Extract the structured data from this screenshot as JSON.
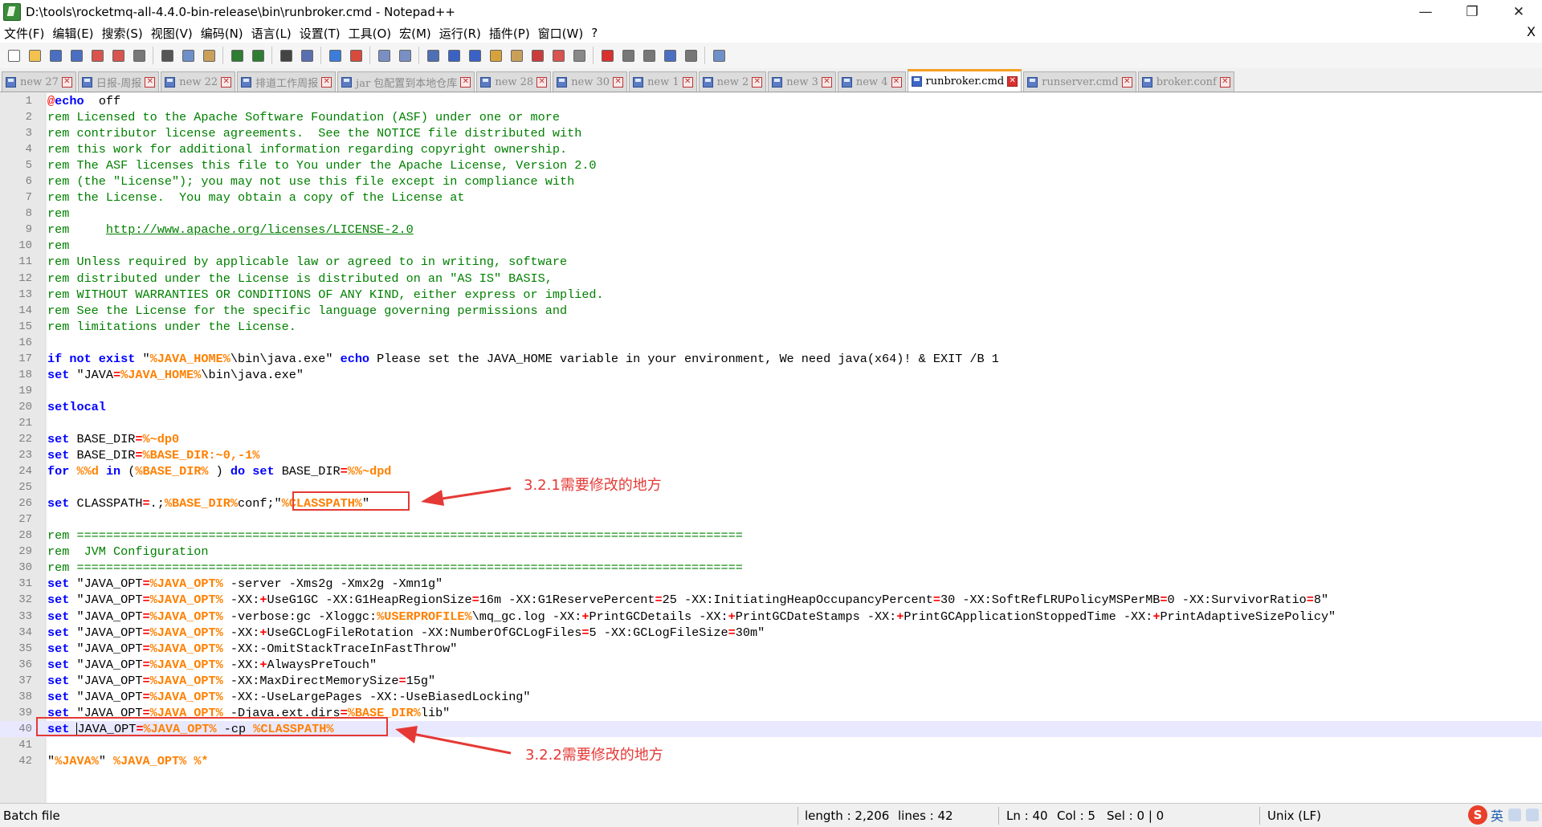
{
  "window": {
    "title": "D:\\tools\\rocketmq-all-4.4.0-bin-release\\bin\\runbroker.cmd - Notepad++",
    "minimize_glyph": "—",
    "restore_glyph": "❐",
    "close_glyph": "✕"
  },
  "menu": {
    "items": [
      "文件(F)",
      "编辑(E)",
      "搜索(S)",
      "视图(V)",
      "编码(N)",
      "语言(L)",
      "设置(T)",
      "工具(O)",
      "宏(M)",
      "运行(R)",
      "插件(P)",
      "窗口(W)",
      "?"
    ],
    "close_glyph": "X"
  },
  "toolbar": {
    "icons": [
      {
        "name": "new-file-icon",
        "color": "#ffffff"
      },
      {
        "name": "open-file-icon",
        "color": "#f2c14e"
      },
      {
        "name": "save-icon",
        "color": "#4a6fc2"
      },
      {
        "name": "save-all-icon",
        "color": "#4a6fc2"
      },
      {
        "name": "close-icon",
        "color": "#d9534f"
      },
      {
        "name": "close-all-icon",
        "color": "#d9534f"
      },
      {
        "name": "print-icon",
        "color": "#777777"
      },
      {
        "name": "sep"
      },
      {
        "name": "cut-icon",
        "color": "#555555"
      },
      {
        "name": "copy-icon",
        "color": "#6f8fc9"
      },
      {
        "name": "paste-icon",
        "color": "#c9a05a"
      },
      {
        "name": "sep"
      },
      {
        "name": "undo-icon",
        "color": "#2e7d32"
      },
      {
        "name": "redo-icon",
        "color": "#2e7d32"
      },
      {
        "name": "sep"
      },
      {
        "name": "find-icon",
        "color": "#444444"
      },
      {
        "name": "replace-icon",
        "color": "#5a6fb0"
      },
      {
        "name": "sep"
      },
      {
        "name": "zoom-in-icon",
        "color": "#3b7dd8"
      },
      {
        "name": "zoom-out-icon",
        "color": "#d84a3b"
      },
      {
        "name": "sep"
      },
      {
        "name": "sync-vertical-icon",
        "color": "#7a8fc4"
      },
      {
        "name": "sync-horizontal-icon",
        "color": "#7a8fc4"
      },
      {
        "name": "sep"
      },
      {
        "name": "word-wrap-icon",
        "color": "#4f6fb5"
      },
      {
        "name": "show-all-chars-icon",
        "color": "#3a62c5"
      },
      {
        "name": "indent-guide-icon",
        "color": "#3a62c5"
      },
      {
        "name": "user-language-icon",
        "color": "#d8a23b"
      },
      {
        "name": "doc-map-icon",
        "color": "#c9a05a"
      },
      {
        "name": "function-list-icon",
        "color": "#cc3b3b"
      },
      {
        "name": "folder-workspace-icon",
        "color": "#d9534f"
      },
      {
        "name": "monitoring-icon",
        "color": "#888888"
      },
      {
        "name": "sep"
      },
      {
        "name": "record-macro-icon",
        "color": "#d9312f"
      },
      {
        "name": "stop-macro-icon",
        "color": "#777777"
      },
      {
        "name": "play-macro-icon",
        "color": "#777777"
      },
      {
        "name": "run-macro-multiple-icon",
        "color": "#4a6fc2"
      },
      {
        "name": "save-macro-icon",
        "color": "#777777"
      },
      {
        "name": "sep"
      },
      {
        "name": "spell-check-icon",
        "color": "#6f8fc9"
      }
    ]
  },
  "tabs": [
    {
      "label": "new 27",
      "active": false
    },
    {
      "label": "日报-周报",
      "active": false
    },
    {
      "label": "new 22",
      "active": false
    },
    {
      "label": "排道工作周报",
      "active": false
    },
    {
      "label": "jar 包配置到本地仓库",
      "active": false
    },
    {
      "label": "new 28",
      "active": false
    },
    {
      "label": "new 30",
      "active": false
    },
    {
      "label": "new 1",
      "active": false
    },
    {
      "label": "new 2",
      "active": false
    },
    {
      "label": "new 3",
      "active": false
    },
    {
      "label": "new 4",
      "active": false
    },
    {
      "label": "runbroker.cmd",
      "active": true
    },
    {
      "label": "runserver.cmd",
      "active": false
    },
    {
      "label": "broker.conf",
      "active": false
    }
  ],
  "tab_close_glyph": "✕",
  "editor": {
    "current_line": 40,
    "lines": [
      [
        [
          "at",
          "@"
        ],
        [
          "kw",
          "echo"
        ],
        [
          "",
          "  off"
        ]
      ],
      [
        [
          "rem",
          "rem Licensed to the Apache Software Foundation (ASF) under one or more"
        ]
      ],
      [
        [
          "rem",
          "rem contributor license agreements.  See the NOTICE file distributed with"
        ]
      ],
      [
        [
          "rem",
          "rem this work for additional information regarding copyright ownership."
        ]
      ],
      [
        [
          "rem",
          "rem The ASF licenses this file to You under the Apache License, Version 2.0"
        ]
      ],
      [
        [
          "rem",
          "rem (the \"License\"); you may not use this file except in compliance with"
        ]
      ],
      [
        [
          "rem",
          "rem the License.  You may obtain a copy of the License at"
        ]
      ],
      [
        [
          "rem",
          "rem"
        ]
      ],
      [
        [
          "rem",
          "rem     "
        ],
        [
          "url",
          "http://www.apache.org/licenses/LICENSE-2.0"
        ]
      ],
      [
        [
          "rem",
          "rem"
        ]
      ],
      [
        [
          "rem",
          "rem Unless required by applicable law or agreed to in writing, software"
        ]
      ],
      [
        [
          "rem",
          "rem distributed under the License is distributed on an \"AS IS\" BASIS,"
        ]
      ],
      [
        [
          "rem",
          "rem WITHOUT WARRANTIES OR CONDITIONS OF ANY KIND, either express or implied."
        ]
      ],
      [
        [
          "rem",
          "rem See the License for the specific language governing permissions and"
        ]
      ],
      [
        [
          "rem",
          "rem limitations under the License."
        ]
      ],
      [],
      [
        [
          "kw",
          "if not exist"
        ],
        [
          "",
          " \""
        ],
        [
          "var",
          "%JAVA_HOME%"
        ],
        [
          "",
          "\\bin\\java.exe\" "
        ],
        [
          "kw",
          "echo"
        ],
        [
          "",
          " Please set the JAVA_HOME variable in your environment, We need java(x64)! & EXIT /B 1"
        ]
      ],
      [
        [
          "kw",
          "set"
        ],
        [
          "",
          " \"JAVA"
        ],
        [
          "op",
          "="
        ],
        [
          "var",
          "%JAVA_HOME%"
        ],
        [
          "",
          "\\bin\\java.exe\""
        ]
      ],
      [],
      [
        [
          "kw",
          "setlocal"
        ]
      ],
      [],
      [
        [
          "kw",
          "set"
        ],
        [
          "",
          " BASE_DIR"
        ],
        [
          "op",
          "="
        ],
        [
          "var",
          "%~dp0"
        ]
      ],
      [
        [
          "kw",
          "set"
        ],
        [
          "",
          " BASE_DIR"
        ],
        [
          "op",
          "="
        ],
        [
          "var",
          "%BASE_DIR:~0,-1%"
        ]
      ],
      [
        [
          "kw",
          "for"
        ],
        [
          "",
          " "
        ],
        [
          "var",
          "%%d"
        ],
        [
          "",
          " "
        ],
        [
          "kw",
          "in"
        ],
        [
          "",
          " ("
        ],
        [
          "var",
          "%BASE_DIR%"
        ],
        [
          "",
          " ) "
        ],
        [
          "kw",
          "do set"
        ],
        [
          "",
          " BASE_DIR"
        ],
        [
          "op",
          "="
        ],
        [
          "var",
          "%%~dpd"
        ]
      ],
      [],
      [
        [
          "kw",
          "set"
        ],
        [
          "",
          " CLASSPATH"
        ],
        [
          "op",
          "="
        ],
        [
          "",
          ".;"
        ],
        [
          "var",
          "%BASE_DIR%"
        ],
        [
          "",
          "conf;\""
        ],
        [
          "var",
          "%CLASSPATH%"
        ],
        [
          "",
          "\""
        ]
      ],
      [],
      [
        [
          "rem",
          "rem ==========================================================================================="
        ]
      ],
      [
        [
          "rem",
          "rem  JVM Configuration"
        ]
      ],
      [
        [
          "rem",
          "rem ==========================================================================================="
        ]
      ],
      [
        [
          "kw",
          "set"
        ],
        [
          "",
          " \"JAVA_OPT"
        ],
        [
          "op",
          "="
        ],
        [
          "var",
          "%JAVA_OPT%"
        ],
        [
          "",
          " -server -Xms2g -Xmx2g -Xmn1g\""
        ]
      ],
      [
        [
          "kw",
          "set"
        ],
        [
          "",
          " \"JAVA_OPT"
        ],
        [
          "op",
          "="
        ],
        [
          "var",
          "%JAVA_OPT%"
        ],
        [
          "",
          " -XX:"
        ],
        [
          "op",
          "+"
        ],
        [
          "",
          "UseG1GC -XX:G1HeapRegionSize"
        ],
        [
          "op",
          "="
        ],
        [
          "",
          "16m -XX:G1ReservePercent"
        ],
        [
          "op",
          "="
        ],
        [
          "",
          "25 -XX:InitiatingHeapOccupancyPercent"
        ],
        [
          "op",
          "="
        ],
        [
          "",
          "30 -XX:SoftRefLRUPolicyMSPerMB"
        ],
        [
          "op",
          "="
        ],
        [
          "",
          "0 -XX:SurvivorRatio"
        ],
        [
          "op",
          "="
        ],
        [
          "",
          "8\""
        ]
      ],
      [
        [
          "kw",
          "set"
        ],
        [
          "",
          " \"JAVA_OPT"
        ],
        [
          "op",
          "="
        ],
        [
          "var",
          "%JAVA_OPT%"
        ],
        [
          "",
          " -verbose:gc -Xloggc:"
        ],
        [
          "var",
          "%USERPROFILE%"
        ],
        [
          "",
          "\\mq_gc.log -XX:"
        ],
        [
          "op",
          "+"
        ],
        [
          "",
          "PrintGCDetails -XX:"
        ],
        [
          "op",
          "+"
        ],
        [
          "",
          "PrintGCDateStamps -XX:"
        ],
        [
          "op",
          "+"
        ],
        [
          "",
          "PrintGCApplicationStoppedTime -XX:"
        ],
        [
          "op",
          "+"
        ],
        [
          "",
          "PrintAdaptiveSizePolicy\""
        ]
      ],
      [
        [
          "kw",
          "set"
        ],
        [
          "",
          " \"JAVA_OPT"
        ],
        [
          "op",
          "="
        ],
        [
          "var",
          "%JAVA_OPT%"
        ],
        [
          "",
          " -XX:"
        ],
        [
          "op",
          "+"
        ],
        [
          "",
          "UseGCLogFileRotation -XX:NumberOfGCLogFiles"
        ],
        [
          "op",
          "="
        ],
        [
          "",
          "5 -XX:GCLogFileSize"
        ],
        [
          "op",
          "="
        ],
        [
          "",
          "30m\""
        ]
      ],
      [
        [
          "kw",
          "set"
        ],
        [
          "",
          " \"JAVA_OPT"
        ],
        [
          "op",
          "="
        ],
        [
          "var",
          "%JAVA_OPT%"
        ],
        [
          "",
          " -XX:-OmitStackTraceInFastThrow\""
        ]
      ],
      [
        [
          "kw",
          "set"
        ],
        [
          "",
          " \"JAVA_OPT"
        ],
        [
          "op",
          "="
        ],
        [
          "var",
          "%JAVA_OPT%"
        ],
        [
          "",
          " -XX:"
        ],
        [
          "op",
          "+"
        ],
        [
          "",
          "AlwaysPreTouch\""
        ]
      ],
      [
        [
          "kw",
          "set"
        ],
        [
          "",
          " \"JAVA_OPT"
        ],
        [
          "op",
          "="
        ],
        [
          "var",
          "%JAVA_OPT%"
        ],
        [
          "",
          " -XX:MaxDirectMemorySize"
        ],
        [
          "op",
          "="
        ],
        [
          "",
          "15g\""
        ]
      ],
      [
        [
          "kw",
          "set"
        ],
        [
          "",
          " \"JAVA_OPT"
        ],
        [
          "op",
          "="
        ],
        [
          "var",
          "%JAVA_OPT%"
        ],
        [
          "",
          " -XX:-UseLargePages -XX:-UseBiasedLocking\""
        ]
      ],
      [
        [
          "kw",
          "set"
        ],
        [
          "",
          " \"JAVA_OPT"
        ],
        [
          "op",
          "="
        ],
        [
          "var",
          "%JAVA_OPT%"
        ],
        [
          "",
          " -Djava.ext.dirs"
        ],
        [
          "op",
          "="
        ],
        [
          "var",
          "%BASE_DIR%"
        ],
        [
          "",
          "lib\""
        ]
      ],
      [
        [
          "kw",
          "set"
        ],
        [
          "",
          " "
        ],
        [
          "cursor",
          ""
        ],
        [
          "",
          "JAVA_OPT"
        ],
        [
          "op",
          "="
        ],
        [
          "var",
          "%JAVA_OPT%"
        ],
        [
          "",
          " -cp "
        ],
        [
          "var",
          "%CLASSPATH%"
        ]
      ],
      [],
      [
        [
          "",
          "\""
        ],
        [
          "var",
          "%JAVA%"
        ],
        [
          "",
          "\" "
        ],
        [
          "var",
          "%JAVA_OPT%"
        ],
        [
          "",
          " "
        ],
        [
          "var",
          "%*"
        ]
      ]
    ]
  },
  "annotations": {
    "label_1": "3.2.1需要修改的地方",
    "label_2": "3.2.2需要修改的地方",
    "color": "#e53935"
  },
  "statusbar": {
    "language": "Batch file",
    "length": "length : 2,206",
    "lines": "lines : 42",
    "ln": "Ln : 40",
    "col": "Col : 5",
    "sel": "Sel : 0 | 0",
    "eol": "Unix (LF)",
    "ime_logo": "S",
    "ime_lang": "英"
  }
}
